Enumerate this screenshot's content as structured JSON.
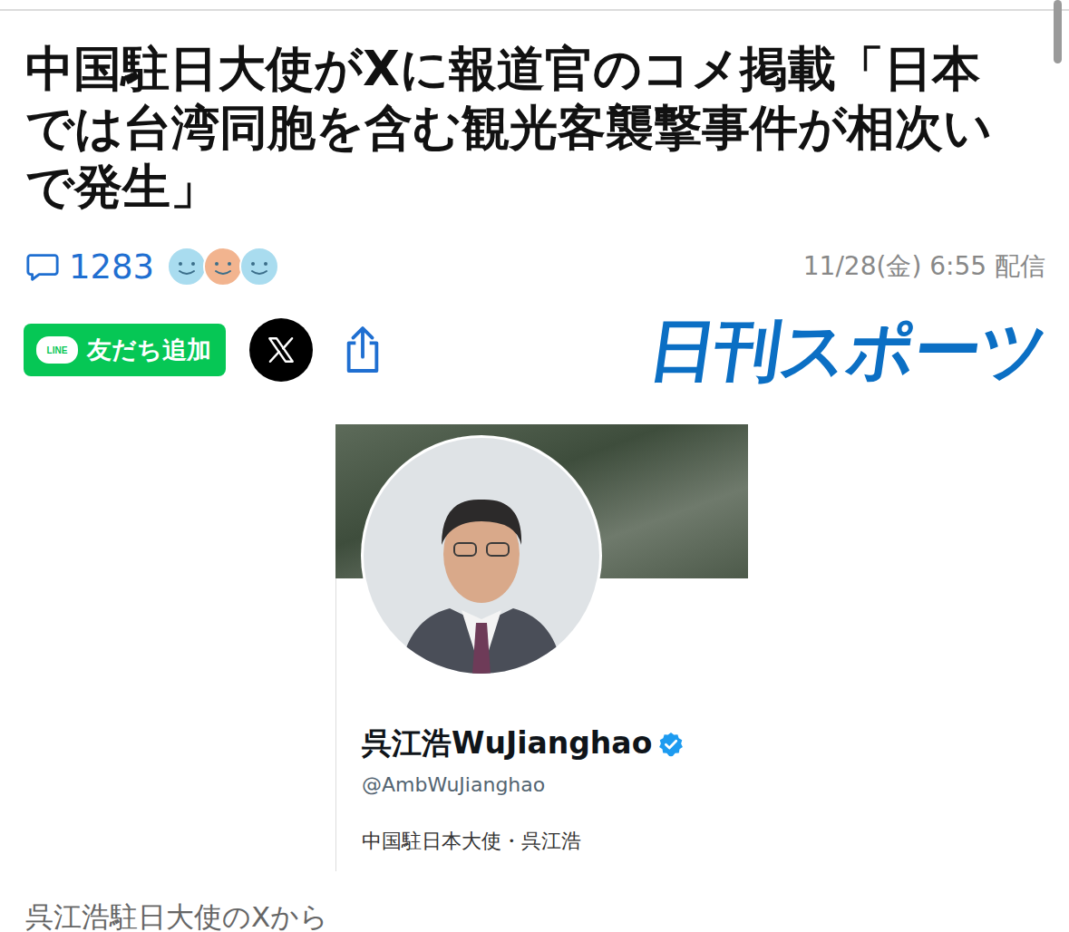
{
  "article": {
    "headline": "中国駐日大使がXに報道官のコメ掲載「日本では台湾同胞を含む観光客襲撃事件が相次いで発生」",
    "comments": {
      "count": "1283"
    },
    "reactions": [
      {
        "color": "#a9dcef"
      },
      {
        "color": "#f2b48f"
      },
      {
        "color": "#a9dcef"
      }
    ],
    "published": "11/28(金) 6:55 配信",
    "actions": [
      {
        "kind": "line",
        "logo_text": "LINE",
        "label": "友だち追加"
      },
      {
        "kind": "x"
      },
      {
        "kind": "share"
      }
    ],
    "publisher": "日刊スポーツ"
  },
  "figure": {
    "profile": {
      "display_name": "呉江浩WuJianghao",
      "verified": true,
      "handle": "@AmbWuJianghao",
      "bio": "中国駐日本大使・呉江浩"
    },
    "caption": "呉江浩駐日大使のXから"
  }
}
